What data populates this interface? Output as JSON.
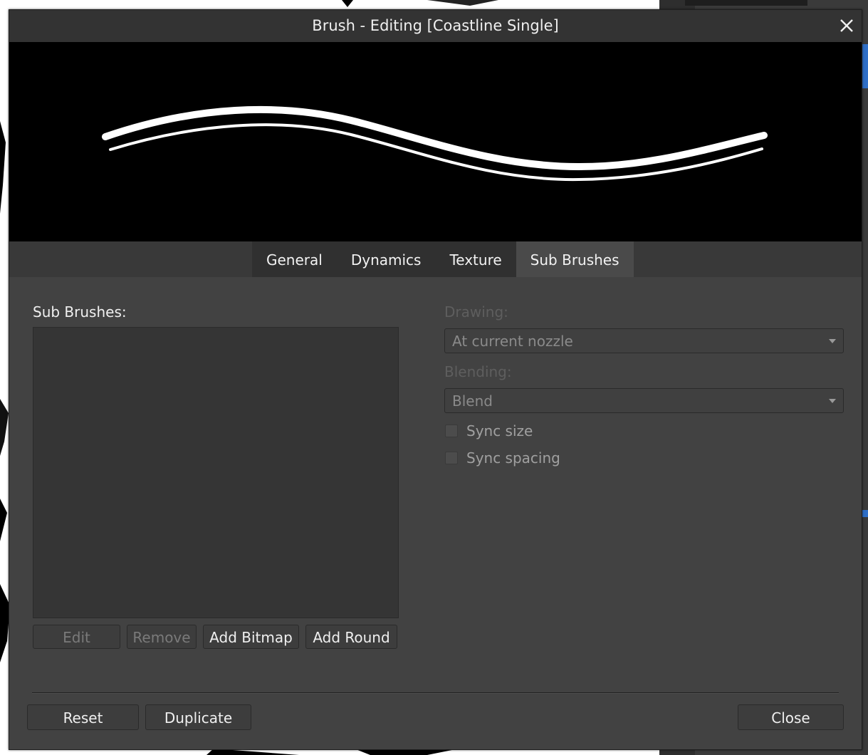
{
  "dialog": {
    "title": "Brush - Editing [Coastline Single]"
  },
  "tabs": [
    {
      "label": "General",
      "active": false
    },
    {
      "label": "Dynamics",
      "active": false
    },
    {
      "label": "Texture",
      "active": false
    },
    {
      "label": "Sub Brushes",
      "active": true
    }
  ],
  "sub_brushes": {
    "label": "Sub Brushes:",
    "items": [],
    "buttons": {
      "edit": "Edit",
      "remove": "Remove",
      "add_bitmap": "Add Bitmap",
      "add_round": "Add Round"
    }
  },
  "settings": {
    "drawing_label": "Drawing:",
    "drawing_value": "At current nozzle",
    "blending_label": "Blending:",
    "blending_value": "Blend",
    "sync_size_label": "Sync size",
    "sync_size_checked": false,
    "sync_spacing_label": "Sync spacing",
    "sync_spacing_checked": false
  },
  "footer": {
    "reset": "Reset",
    "duplicate": "Duplicate",
    "close": "Close"
  },
  "colors": {
    "dialog_bg": "#424242",
    "titlebar_bg": "#333333",
    "preview_bg": "#000000",
    "stroke": "#ffffff"
  }
}
